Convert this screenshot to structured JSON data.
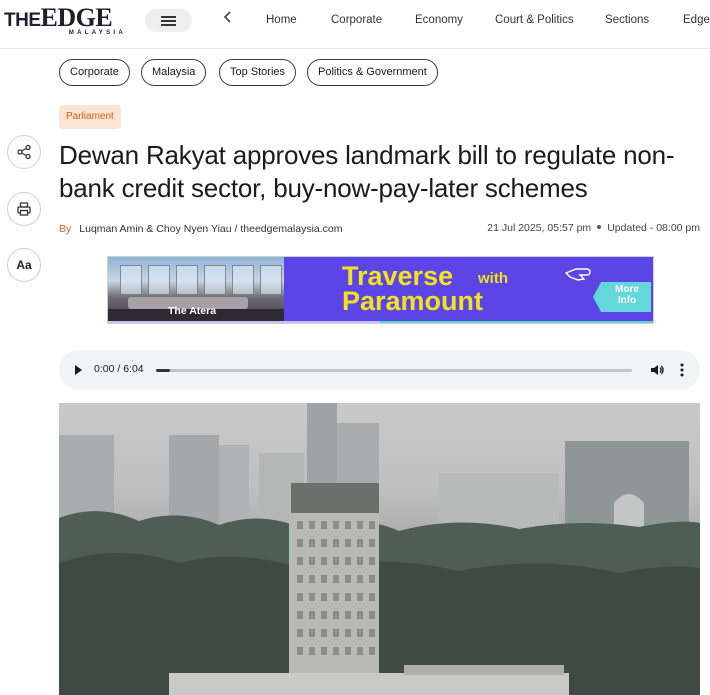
{
  "logo": {
    "prefix": "THE",
    "word": "EDGE",
    "sub": "MALAYSIA"
  },
  "nav": {
    "items": [
      {
        "key": "home",
        "label": "Home"
      },
      {
        "key": "corporate",
        "label": "Corporate"
      },
      {
        "key": "economy",
        "label": "Economy"
      },
      {
        "key": "court-politics",
        "label": "Court & Politics"
      },
      {
        "key": "sections",
        "label": "Sections"
      },
      {
        "key": "edge-truncated",
        "label": "EdgeT"
      }
    ]
  },
  "tags": [
    "Corporate",
    "Malaysia",
    "Top Stories",
    "Politics & Government"
  ],
  "article": {
    "category": "Parliament",
    "headline": "Dewan Rakyat approves landmark bill to regulate non-bank credit sector, buy-now-pay-later schemes",
    "byline_prefix": "By",
    "authors": "Luqman Amin & Choy Nyen Yiau /",
    "source": "theedgemalaysia.com",
    "published": "21 Jul 2025, 05:57 pm",
    "updated": "Updated - 08:00 pm"
  },
  "sidebar": {
    "font_size_label": "Aa"
  },
  "ad": {
    "photo_caption": "The Atera",
    "headline_1": "Traverse",
    "headline_with": "with",
    "headline_2": "Paramount",
    "cta": "More Info"
  },
  "audio": {
    "time": "0:00 / 6:04",
    "progress": 0.0
  },
  "colors": {
    "accent": "#d2641c",
    "category_bg": "#fbe4d3",
    "ad_bg": "#5b45e6",
    "ad_text": "#f3e21c",
    "ad_cta": "#62d8da"
  },
  "icons": {
    "menu": "hamburger-icon",
    "back": "chevron-left-icon",
    "share": "share-icon",
    "print": "print-icon",
    "play": "play-icon",
    "volume": "volume-icon",
    "more": "more-vertical-icon"
  }
}
